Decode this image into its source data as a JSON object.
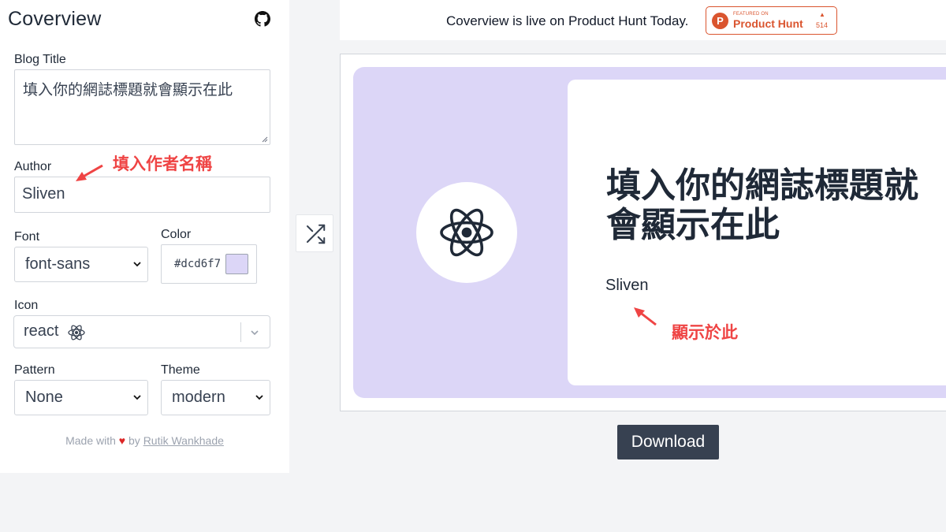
{
  "app": {
    "title": "Coverview"
  },
  "form": {
    "blog_title_label": "Blog Title",
    "blog_title_value": "填入你的網誌標題就會顯示在此",
    "author_label": "Author",
    "author_value": "Sliven",
    "font_label": "Font",
    "font_value": "font-sans",
    "color_label": "Color",
    "color_value": "#dcd6f7",
    "icon_label": "Icon",
    "icon_value": "react",
    "icon_name": "react-atom-icon",
    "pattern_label": "Pattern",
    "pattern_value": "None",
    "theme_label": "Theme",
    "theme_value": "modern"
  },
  "footer": {
    "made_with": "Made with",
    "by": "by",
    "author_link": "Rutik Wankhade"
  },
  "banner": {
    "text": "Coverview is live on Product Hunt Today.",
    "ph_featured": "FEATURED ON",
    "ph_name": "Product Hunt",
    "ph_votes": "514"
  },
  "preview": {
    "title": "填入你的網誌標題就會顯示在此",
    "author": "Sliven",
    "bg_color": "#dcd6f7"
  },
  "actions": {
    "download_label": "Download"
  },
  "annotations": {
    "author_note": "填入作者名稱",
    "preview_note": "顯示於此"
  },
  "colors": {
    "accent": "#374151",
    "product_hunt": "#da552f",
    "annotation": "#ef4444"
  }
}
